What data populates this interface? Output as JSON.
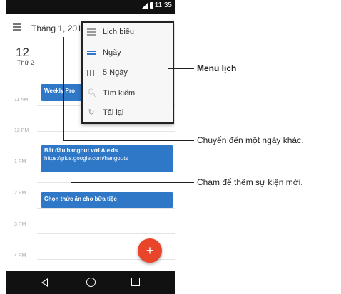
{
  "status": {
    "time": "11:35"
  },
  "appbar": {
    "month": "Tháng 1, 2015"
  },
  "menu": {
    "items": [
      {
        "label": "Lịch biểu",
        "icon": "list-icon"
      },
      {
        "label": "Ngày",
        "icon": "day-view-icon"
      },
      {
        "label": "5 Ngày",
        "icon": "five-day-icon"
      },
      {
        "label": "Tìm kiếm",
        "icon": "search-icon"
      },
      {
        "label": "Tải lại",
        "icon": "refresh-icon"
      }
    ]
  },
  "day": {
    "number": "12",
    "name": "Thứ 2"
  },
  "times": [
    "11 AM",
    "12 PM",
    "1 PM",
    "2 PM",
    "3 PM",
    "4 PM"
  ],
  "events": [
    {
      "title": "Weekly Pro",
      "detail": ""
    },
    {
      "title": "Bắt đầu hangout với Alexis",
      "detail": "https://plus.google.com/hangouts"
    },
    {
      "title": "Chọn thức ăn cho bữa tiệc",
      "detail": ""
    }
  ],
  "callouts": {
    "menu": "Menu lịch",
    "goto_date": "Chuyển đến một ngày khác.",
    "add_event": "Chạm để thêm sự kiện mới."
  },
  "colors": {
    "accent": "#2f78c7",
    "fab": "#e8452b"
  }
}
